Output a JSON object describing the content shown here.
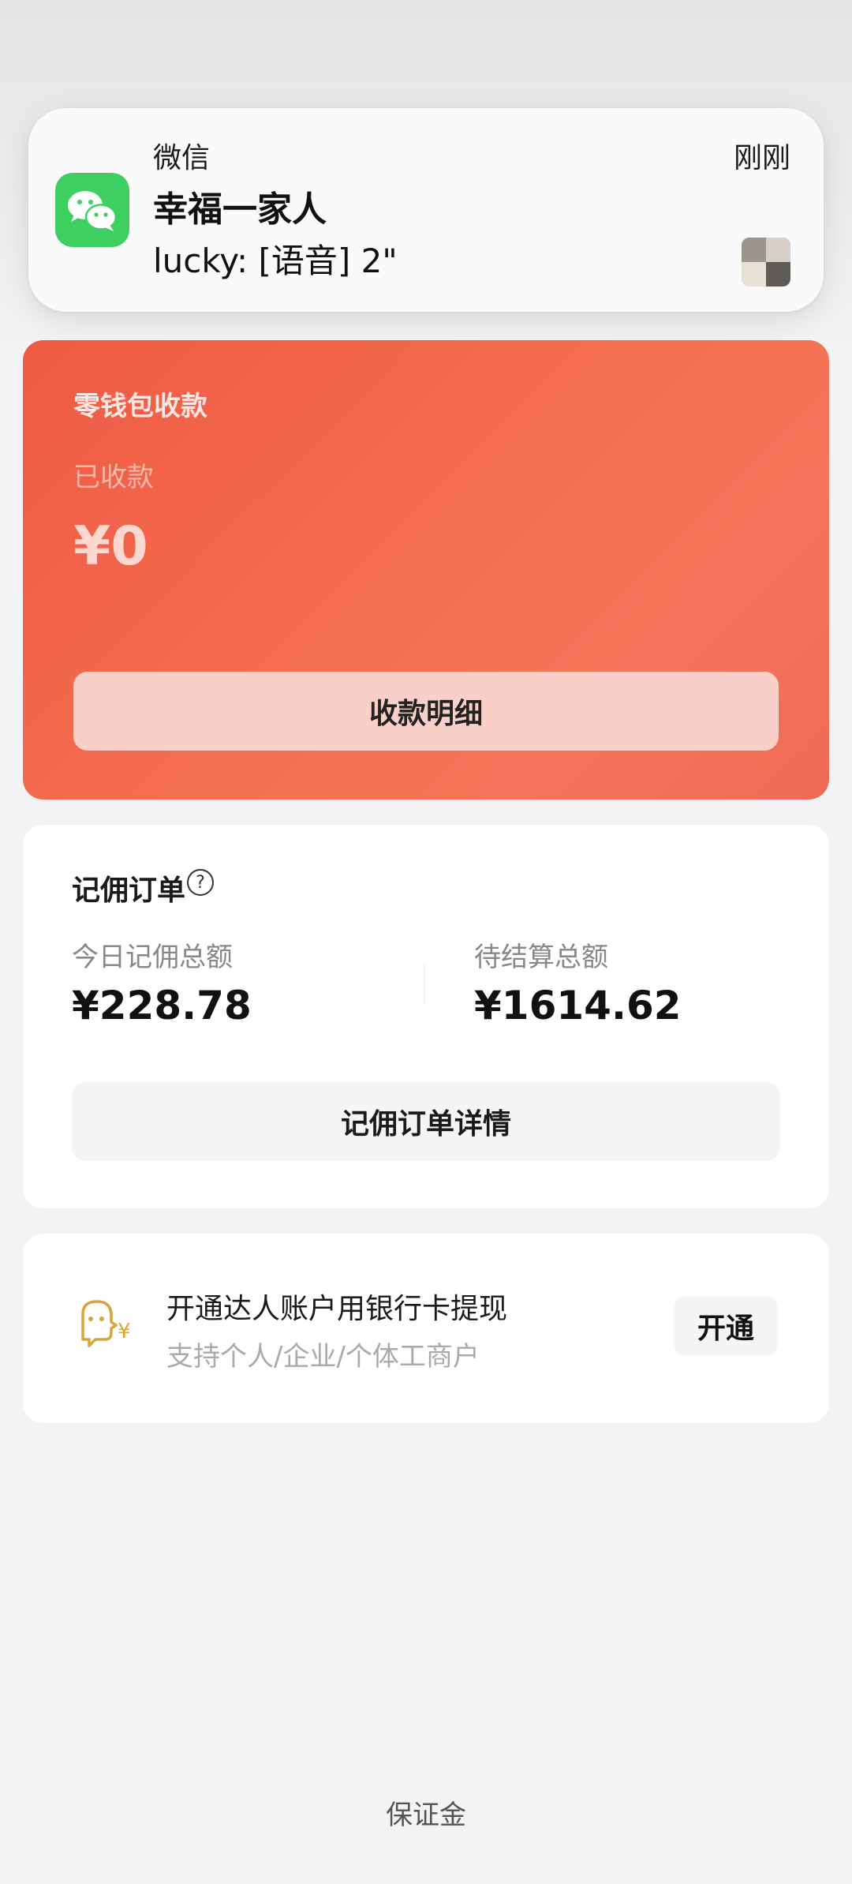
{
  "notification": {
    "app_name": "微信",
    "time": "刚刚",
    "title": "幸福一家人",
    "message": "lucky: [语音] 2\"",
    "app_icon": "wechat-icon",
    "thumbnail": "group-avatar-thumbnail"
  },
  "wallet": {
    "title": "零钱包收款",
    "received_label": "已收款",
    "amount": "¥0",
    "detail_button": "收款明细"
  },
  "commission": {
    "title": "记佣订单",
    "help_icon": "question-circle-icon",
    "today_label": "今日记佣总额",
    "today_value": "¥228.78",
    "pending_label": "待结算总额",
    "pending_value": "¥1614.62",
    "detail_button": "记佣订单详情"
  },
  "bank_withdraw": {
    "icon": "person-yuan-icon",
    "title": "开通达人账户用银行卡提现",
    "subtitle": "支持个人/企业/个体工商户",
    "open_button": "开通"
  },
  "footer": {
    "deposit_link": "保证金"
  },
  "colors": {
    "wallet_card": "#f0624b",
    "wechat_green": "#3dcf5f",
    "bank_icon": "#d8a43c"
  }
}
